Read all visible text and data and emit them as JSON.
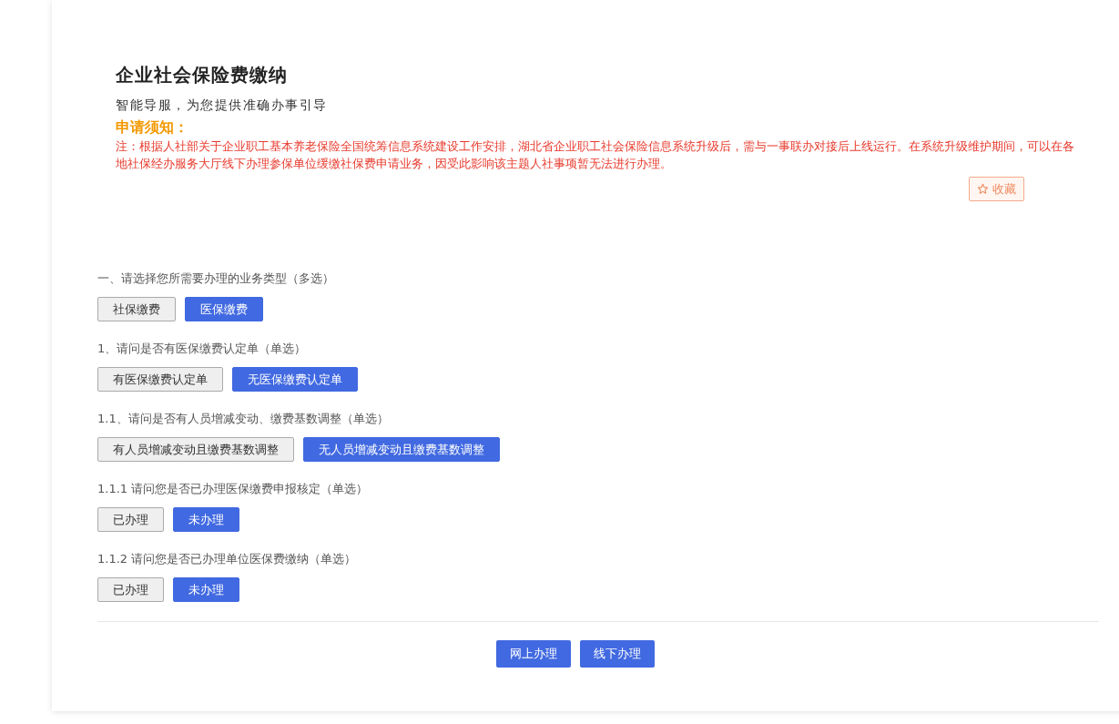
{
  "title": "企业社会保险费缴纳",
  "subtitle": "智能导服，为您提供准确办事引导",
  "notice": {
    "heading": "申请须知：",
    "text": "注：根据人社部关于企业职工基本养老保险全国统筹信息系统建设工作安排，湖北省企业职工社会保险信息系统升级后，需与一事联办对接后上线运行。在系统升级维护期间，可以在各地社保经办服务大厅线下办理参保单位缓缴社保费申请业务，因受此影响该主题人社事项暂无法进行办理。"
  },
  "favorite_button": "收藏",
  "questions": [
    {
      "label": "一、请选择您所需要办理的业务类型（多选）",
      "options": [
        {
          "label": "社保缴费",
          "selected": false
        },
        {
          "label": "医保缴费",
          "selected": true
        }
      ]
    },
    {
      "label": "1、请问是否有医保缴费认定单（单选）",
      "options": [
        {
          "label": "有医保缴费认定单",
          "selected": false
        },
        {
          "label": "无医保缴费认定单",
          "selected": true
        }
      ]
    },
    {
      "label": "1.1、请问是否有人员增减变动、缴费基数调整（单选）",
      "options": [
        {
          "label": "有人员增减变动且缴费基数调整",
          "selected": false
        },
        {
          "label": "无人员增减变动且缴费基数调整",
          "selected": true
        }
      ]
    },
    {
      "label": "1.1.1 请问您是否已办理医保缴费申报核定（单选）",
      "options": [
        {
          "label": "已办理",
          "selected": false
        },
        {
          "label": "未办理",
          "selected": true
        }
      ]
    },
    {
      "label": "1.1.2 请问您是否已办理单位医保费缴纳（单选）",
      "options": [
        {
          "label": "已办理",
          "selected": false
        },
        {
          "label": "未办理",
          "selected": true
        }
      ]
    }
  ],
  "actions": [
    "网上办理",
    "线下办理"
  ]
}
